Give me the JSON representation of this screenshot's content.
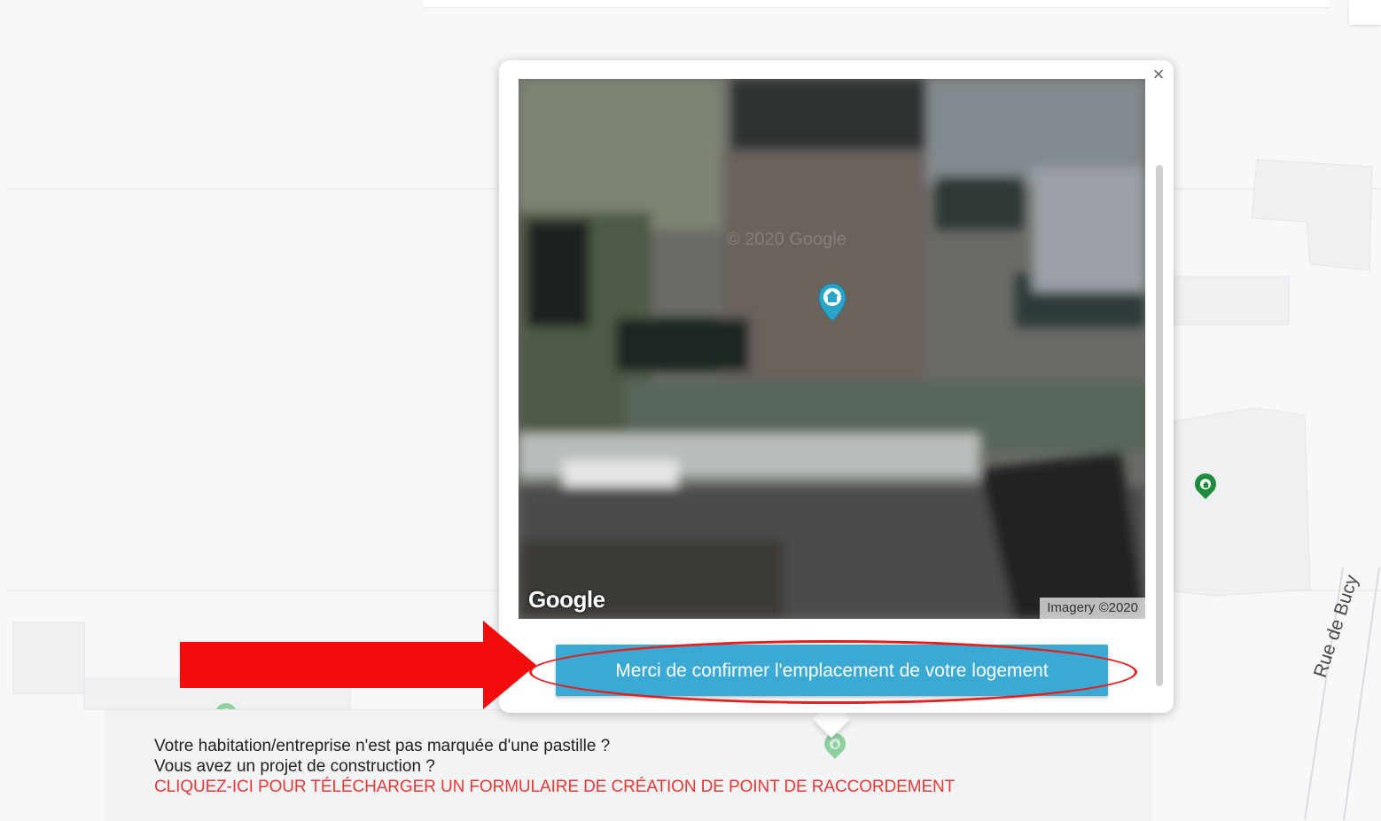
{
  "map": {
    "street_label": "Rue de Bucy"
  },
  "popup": {
    "close_label": "×",
    "imagery": {
      "provider_logo": "Google",
      "credit": "Imagery ©2020",
      "watermark": "© 2020 Google"
    },
    "confirm_button": "Merci de confirmer l'emplacement de votre logement"
  },
  "info": {
    "line1": "Votre habitation/entreprise n'est pas marquée d'une pastille ?",
    "line2": "Vous avez un projet de construction ?",
    "link": "CLIQUEZ-ICI POUR TÉLÉCHARGER UN FORMULAIRE DE CRÉATION DE POINT DE RACCORDEMENT"
  },
  "icons": {
    "close": "close-icon",
    "pin": "house-pin-icon",
    "arrow": "red-arrow-annotation"
  },
  "colors": {
    "confirm_button": "#3aa9d3",
    "link": "#e53935",
    "annotation": "#e31f1f",
    "pin_dark": "#1d8a3d",
    "pin_light": "#8fcfa0",
    "center_pin": "#2aa4c8"
  }
}
